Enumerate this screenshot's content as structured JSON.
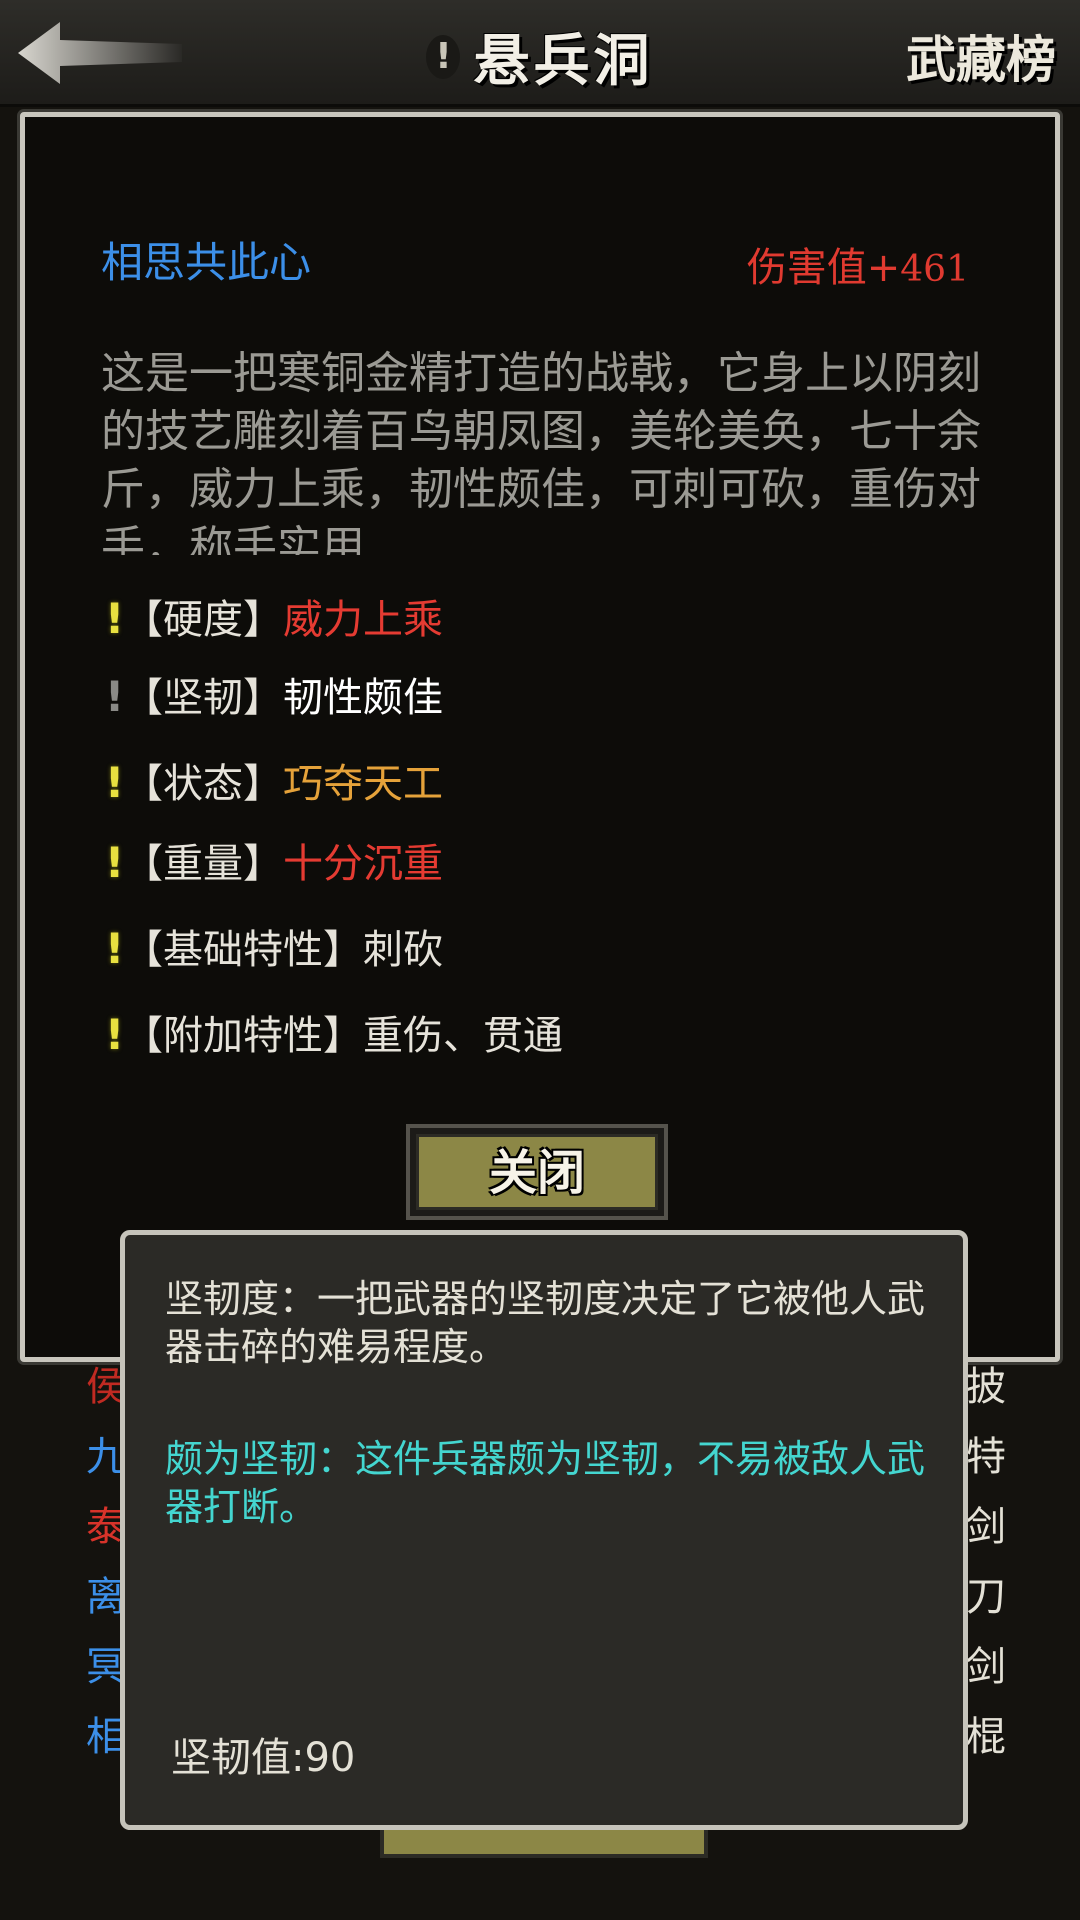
{
  "header": {
    "title": "悬兵洞",
    "title_mark": "!",
    "rank_label": "武藏榜"
  },
  "background": {
    "left_chars": [
      "侯",
      "九",
      "泰",
      "离",
      "冥",
      "相"
    ],
    "right_chars": [
      "披",
      "特",
      "剑",
      "刀",
      "剑",
      "棍"
    ]
  },
  "item": {
    "name": "相思共此心",
    "damage_label": "伤害值+",
    "damage_value": "461",
    "description": "这是一把寒铜金精打造的战戟，它身上以阴刻的技艺雕刻着百鸟朝凤图，美轮美奂，七十余斤，威力上乘，韧性颇佳，可刺可砍，重伤对手，称手实用",
    "attributes": [
      {
        "mark": "!",
        "label": "【硬度】",
        "value": "威力上乘",
        "value_color": "#e53b32"
      },
      {
        "mark": "!",
        "label": "【坚韧】",
        "value": "韧性颇佳",
        "value_color": "#ffffff"
      },
      {
        "mark": "!",
        "label": "【状态】",
        "value": "巧夺天工",
        "value_color": "#e5a23a"
      },
      {
        "mark": "!",
        "label": "【重量】",
        "value": "十分沉重",
        "value_color": "#e53b32"
      },
      {
        "mark": "!",
        "label": "【基础特性】",
        "value": "刺砍",
        "value_color": "#e6e3da"
      },
      {
        "mark": "!",
        "label": "【附加特性】",
        "value": "重伤、贯通",
        "value_color": "#e6e3da"
      }
    ]
  },
  "close_label": "关闭",
  "tooltip": {
    "main": "坚韧度：一把武器的坚韧度决定了它被他人武器击碎的难易程度。",
    "sub": "颇为坚韧：这件兵器颇为坚韧，不易被敌人武器打断。",
    "value": "坚韧值:90"
  }
}
